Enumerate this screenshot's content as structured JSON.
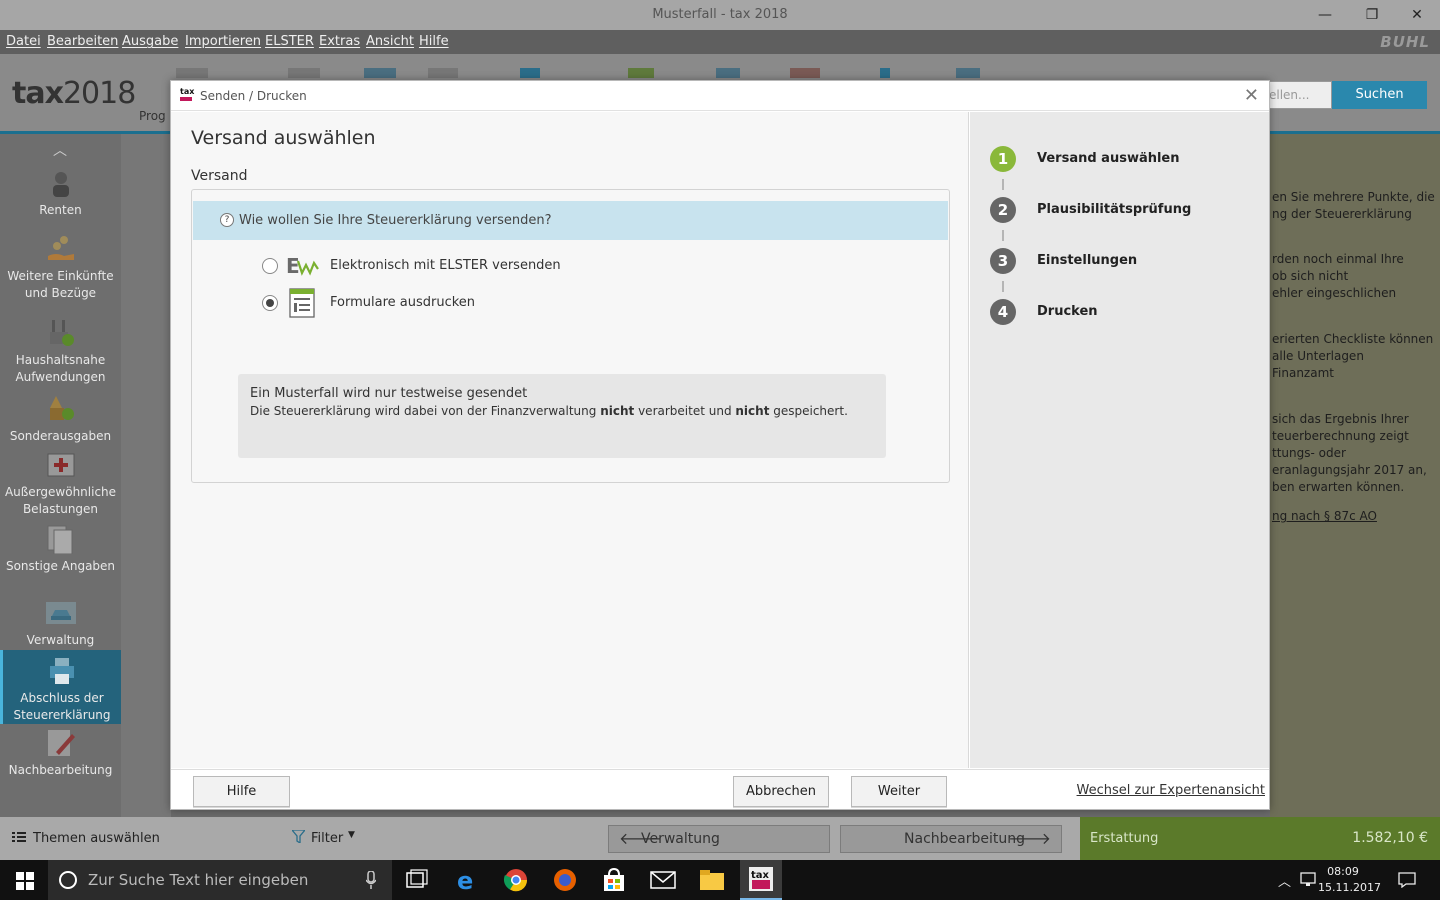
{
  "window": {
    "title": "Musterfall - tax 2018",
    "minimize": "—",
    "maximize": "❐",
    "close": "✕"
  },
  "menu": [
    "Datei",
    "Bearbeiten",
    "Ausgabe",
    "Importieren",
    "ELSTER",
    "Extras",
    "Ansicht",
    "Hilfe"
  ],
  "brand": "BUHL",
  "app": {
    "logo_bold": "tax",
    "logo_year": "2018",
    "toolbar_cut_label": "Prog",
    "search_placeholder": "ellen...",
    "search_button": "Suchen"
  },
  "sidebar": {
    "items": [
      {
        "label": "Renten",
        "icon": "person-icon"
      },
      {
        "label": "Weitere Einkünfte und Bezüge",
        "icon": "money-hand-icon"
      },
      {
        "label": "Haushaltsnahe Aufwendungen",
        "icon": "cleaning-check-icon"
      },
      {
        "label": "Sonderausgaben",
        "icon": "special-expenses-icon"
      },
      {
        "label": "Außergewöhnliche Belastungen",
        "icon": "first-aid-icon"
      },
      {
        "label": "Sonstige Angaben",
        "icon": "documents-icon"
      },
      {
        "label": "Verwaltung",
        "icon": "car-icon"
      },
      {
        "label": "Abschluss der Steuererklärung",
        "icon": "printer-icon"
      },
      {
        "label": "Nachbearbeitung",
        "icon": "edit-icon"
      }
    ]
  },
  "right_panel_lines": [
    "en Sie mehrere Punkte, die",
    "ng der Steuererklärung",
    "rden noch einmal Ihre",
    "ob sich nicht",
    "ehler eingeschlichen",
    "erierten Checkliste können",
    " alle Unterlagen",
    " Finanzamt",
    " sich das Ergebnis Ihrer",
    "teuerberechnung zeigt",
    "ttungs- oder",
    "eranlagungsjahr 2017 an,",
    "ben erwarten können.",
    "ng nach § 87c AO"
  ],
  "bottom": {
    "themen": "Themen auswählen",
    "filter": "Filter",
    "prev": "Verwaltung",
    "next": "Nachbearbeitung",
    "erstattung_label": "Erstattung",
    "erstattung_value": "1.582,10 €"
  },
  "taskbar": {
    "search_placeholder": "Zur Suche Text hier eingeben",
    "time": "08:09",
    "date": "15.11.2017"
  },
  "dialog": {
    "title": "Senden / Drucken",
    "heading": "Versand auswählen",
    "section": "Versand",
    "question": "Wie wollen Sie Ihre Steuererklärung versenden?",
    "options": [
      {
        "label": "Elektronisch mit ELSTER versenden",
        "checked": false
      },
      {
        "label": "Formulare ausdrucken",
        "checked": true
      }
    ],
    "info": {
      "title": "Ein Musterfall wird nur testweise gesendet",
      "text_a": "Die Steuererklärung wird dabei von der Finanzverwaltung ",
      "bold_a": "nicht",
      "text_b": " verarbeitet und ",
      "bold_b": "nicht",
      "text_c": " gespeichert."
    },
    "steps": [
      {
        "num": "1",
        "label": "Versand auswählen",
        "active": true
      },
      {
        "num": "2",
        "label": "Plausibilitätsprüfung",
        "active": false
      },
      {
        "num": "3",
        "label": "Einstellungen",
        "active": false
      },
      {
        "num": "4",
        "label": "Drucken",
        "active": false
      }
    ],
    "buttons": {
      "help": "Hilfe",
      "cancel": "Abbrechen",
      "next": "Weiter"
    },
    "expert_link": "Wechsel zur Expertenansicht"
  },
  "colors": {
    "accent": "#2a88ad",
    "step_active": "#8ab83a",
    "question_bg": "#c8e3ee",
    "erstattung_bg": "#5b7a2a"
  }
}
